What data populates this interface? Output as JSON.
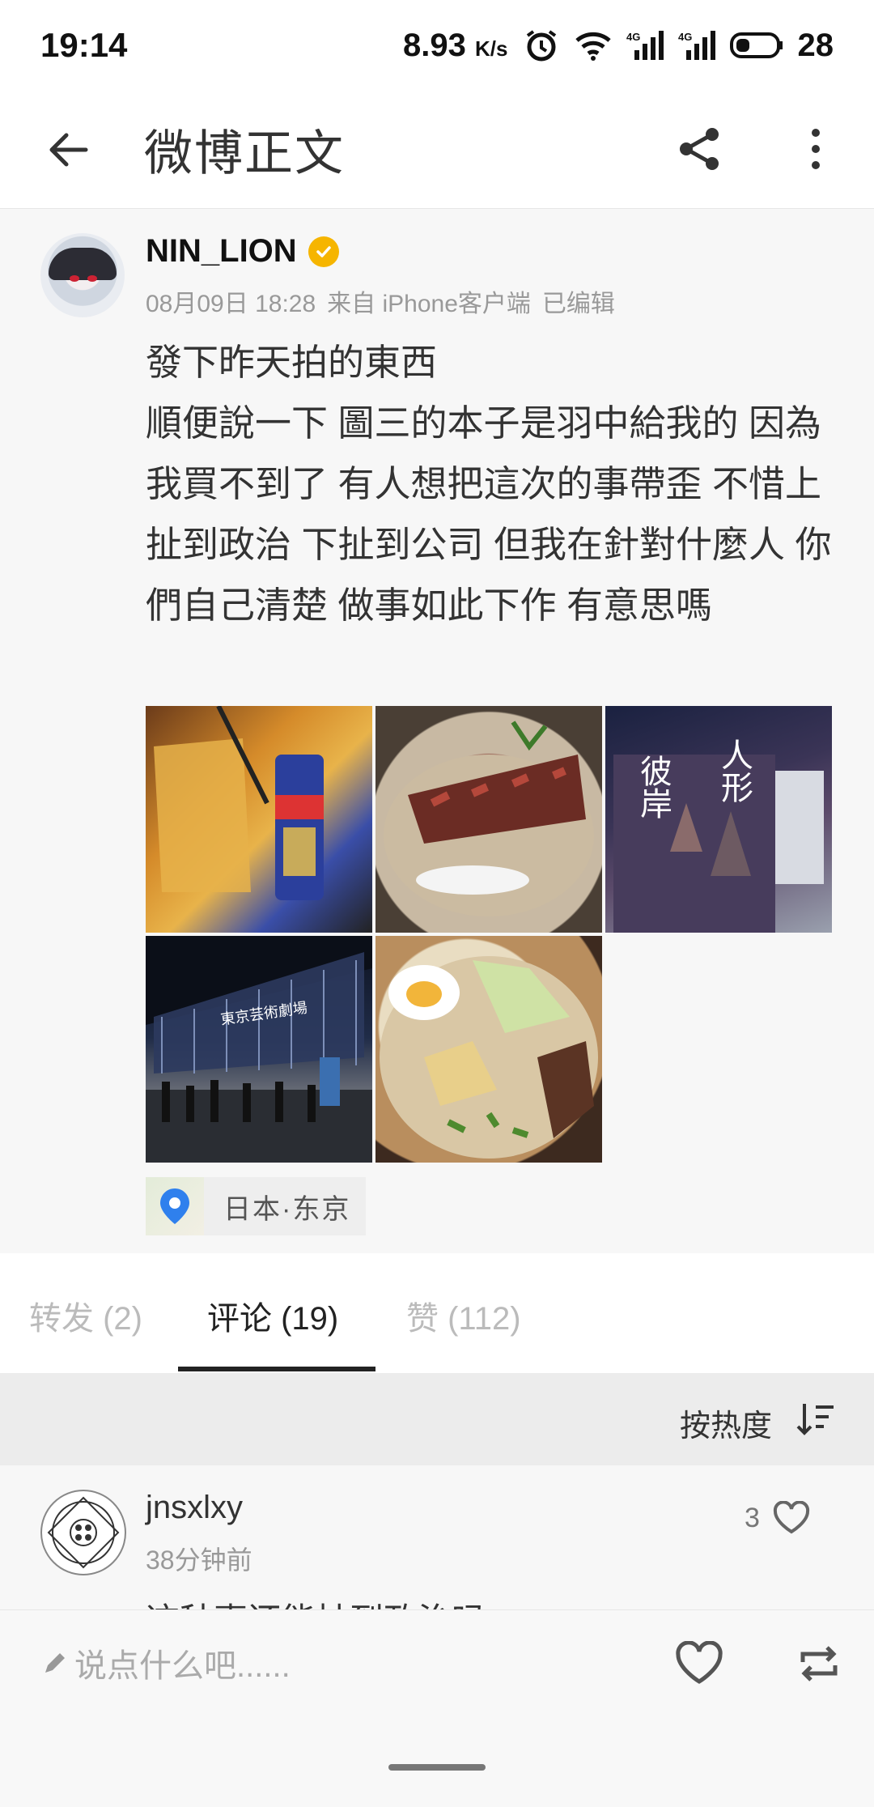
{
  "status_bar": {
    "time": "19:14",
    "net_speed": "8.93",
    "net_unit": "K/s",
    "battery": "28"
  },
  "header": {
    "title": "微博正文"
  },
  "post": {
    "username": "NIN_LION",
    "meta": {
      "date": "08月09日 18:28",
      "source": "来自 iPhone客户端",
      "edited": "已编辑"
    },
    "text": "發下昨天拍的東西\n順便說一下 圖三的本子是羽中給我的 因為我買不到了 有人想把這次的事帶歪 不惜上扯到政治 下扯到公司 但我在針對什麼人 你們自己清楚 做事如此下作 有意思嗎",
    "photo3_caption_left": "彼岸",
    "photo3_caption_right": "人形",
    "photo4_sign": "東京芸術劇場",
    "location": "日本·东京"
  },
  "tabs": {
    "repost": "转发 (2)",
    "comment": "评论 (19)",
    "like": "赞 (112)"
  },
  "sort": {
    "label": "按热度"
  },
  "comment": {
    "name": "jnsxlxy",
    "time": "38分钟前",
    "likes": "3",
    "text": "这种事还能扯到政治吗"
  },
  "bottom": {
    "placeholder": "说点什么吧......"
  },
  "colors": {
    "verified_badge": "#f6b500",
    "location_pin": "#2f80ed"
  }
}
